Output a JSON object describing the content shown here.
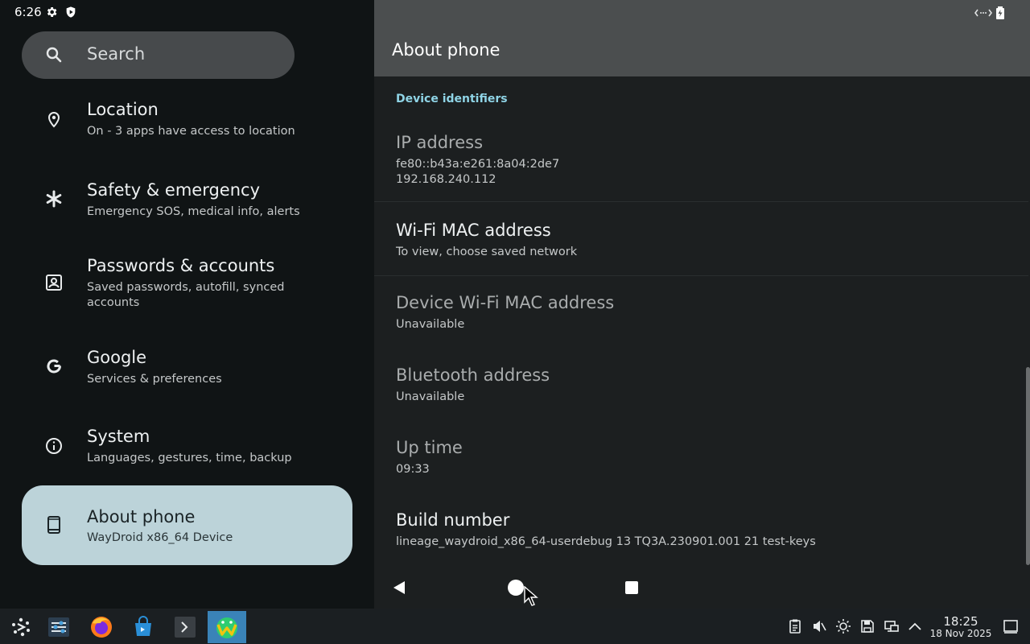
{
  "status_bar": {
    "time": "6:26"
  },
  "search": {
    "placeholder": "Search"
  },
  "sidebar": {
    "items": [
      {
        "title": "Location",
        "subtitle": "On - 3 apps have access to location",
        "icon": "location-pin-icon"
      },
      {
        "title": "Safety & emergency",
        "subtitle": "Emergency SOS, medical info, alerts",
        "icon": "asterisk-icon"
      },
      {
        "title": "Passwords & accounts",
        "subtitle": "Saved passwords, autofill, synced accounts",
        "icon": "account-box-icon"
      },
      {
        "title": "Google",
        "subtitle": "Services & preferences",
        "icon": "google-icon"
      },
      {
        "title": "System",
        "subtitle": "Languages, gestures, time, backup",
        "icon": "info-icon"
      },
      {
        "title": "About phone",
        "subtitle": "WayDroid x86_64 Device",
        "icon": "phone-icon",
        "selected": true
      }
    ]
  },
  "detail": {
    "title": "About phone",
    "section_header": "Device identifiers",
    "prefs": [
      {
        "title": "IP address",
        "subtitle": "fe80::b43a:e261:8a04:2de7\n192.168.240.112",
        "enabled": false
      },
      {
        "title": "Wi-Fi MAC address",
        "subtitle": "To view, choose saved network",
        "enabled": true
      },
      {
        "title": "Device Wi-Fi MAC address",
        "subtitle": "Unavailable",
        "enabled": false
      },
      {
        "title": "Bluetooth address",
        "subtitle": "Unavailable",
        "enabled": false
      },
      {
        "title": "Up time",
        "subtitle": "09:33",
        "enabled": false
      },
      {
        "title": "Build number",
        "subtitle": "lineage_waydroid_x86_64-userdebug 13 TQ3A.230901.001 21 test-keys",
        "enabled": true
      }
    ]
  },
  "taskbar": {
    "clock_time": "18:25",
    "clock_date": "18 Nov 2025",
    "apps": [
      "app-launcher-icon",
      "settings-sliders-icon",
      "firefox-icon",
      "store-icon",
      "terminal-icon",
      "waydroid-icon"
    ]
  },
  "colors": {
    "accent": "#8fd4e6",
    "selected_bg": "#bcd3d9",
    "taskbar_active": "#3a83b8"
  }
}
